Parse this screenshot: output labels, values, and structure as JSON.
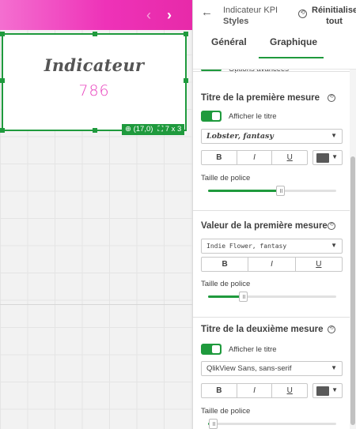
{
  "canvas": {
    "nav_prev": "‹",
    "nav_next": "›",
    "kpi": {
      "title": "Indicateur",
      "value": "786"
    },
    "position_badge": "(17,0)",
    "size_badge": "7 x 3",
    "colors": {
      "topbar": "#ee32b8",
      "selection": "#1f9a3d",
      "value": "#e83fbd"
    }
  },
  "panel": {
    "back_icon": "arrow-left-icon",
    "title_line1": "Indicateur KPI",
    "title_line2": "Styles",
    "reset_all_label": "Réinitialiser tout",
    "tabs": [
      {
        "label": "Général",
        "active": false
      },
      {
        "label": "Graphique",
        "active": true
      }
    ],
    "partial_option_label": "Options avancées",
    "sections": [
      {
        "title": "Titre de la première mesure",
        "show_title_label": "Afficher le titre",
        "font_value": "Lobster, fantasy",
        "bold": "B",
        "italic": "I",
        "underline": "U",
        "color": "#595959",
        "size_label": "Taille de police",
        "size_level": 0.56
      },
      {
        "title": "Valeur de la première mesure",
        "font_value": "Indie Flower, fantasy",
        "bold": "B",
        "italic": "I",
        "underline": "U",
        "size_label": "Taille de police",
        "size_level": 0.27
      },
      {
        "title": "Titre de la deuxième mesure",
        "show_title_label": "Afficher le titre",
        "font_value": "QlikView Sans, sans-serif",
        "bold": "B",
        "italic": "I",
        "underline": "U",
        "color": "#595959",
        "size_label": "Taille de police",
        "size_level": 0.04
      }
    ],
    "accent": "#1f9a3d"
  }
}
